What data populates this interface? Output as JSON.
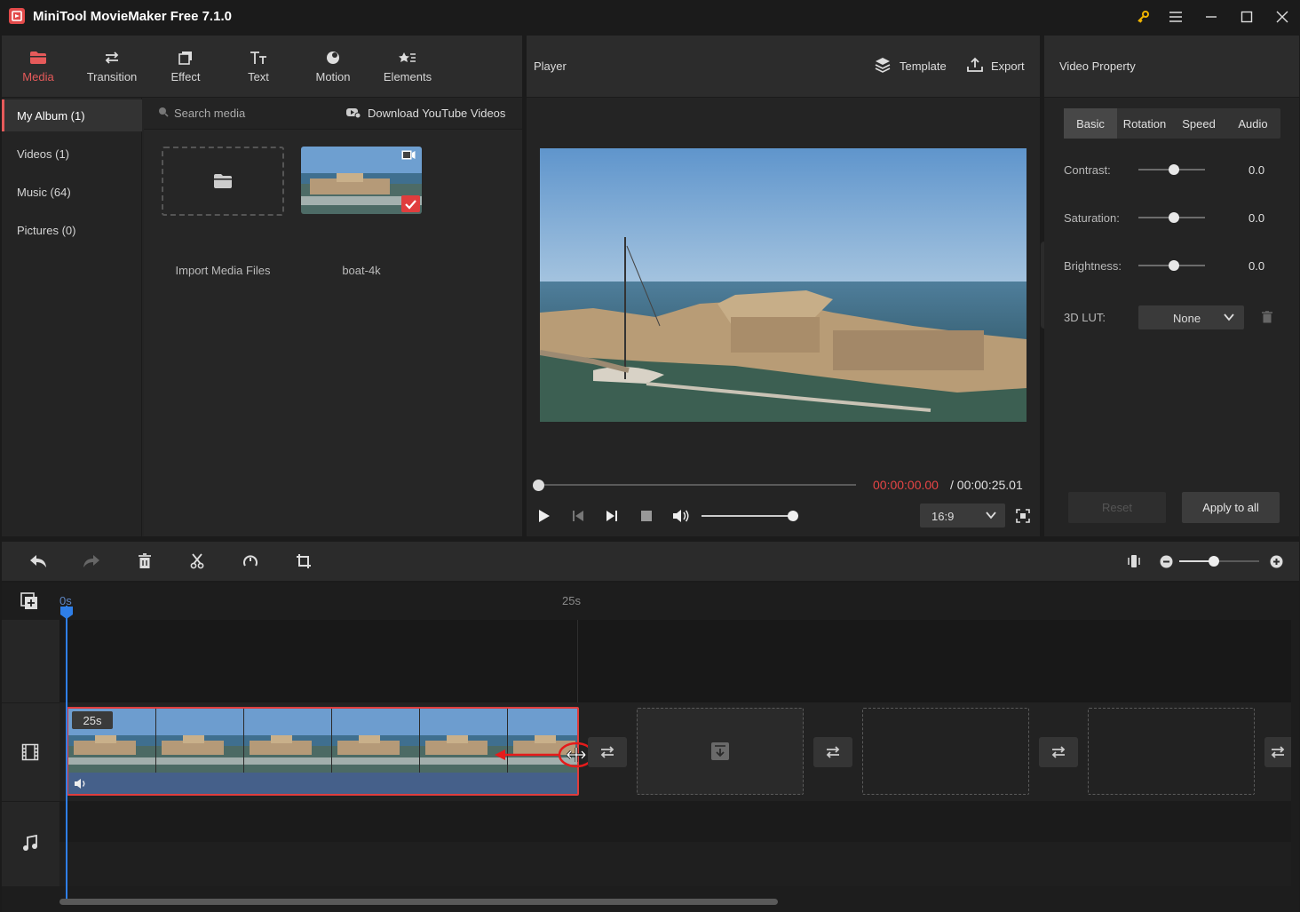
{
  "window": {
    "title": "MiniTool MovieMaker Free 7.1.0"
  },
  "nav_tabs": [
    {
      "label": "Media",
      "icon": "folder-icon",
      "active": true
    },
    {
      "label": "Transition",
      "icon": "swap-arrows-icon"
    },
    {
      "label": "Effect",
      "icon": "effect-icon"
    },
    {
      "label": "Text",
      "icon": "text-icon"
    },
    {
      "label": "Motion",
      "icon": "motion-icon"
    },
    {
      "label": "Elements",
      "icon": "elements-icon"
    }
  ],
  "sidebar": {
    "items": [
      {
        "label": "My Album (1)",
        "active": true
      },
      {
        "label": "Videos (1)"
      },
      {
        "label": "Music (64)"
      },
      {
        "label": "Pictures (0)"
      }
    ]
  },
  "media": {
    "search_placeholder": "Search media",
    "download_label": "Download YouTube Videos",
    "import_label": "Import Media Files",
    "clip_name": "boat-4k"
  },
  "player": {
    "title": "Player",
    "template_label": "Template",
    "export_label": "Export",
    "current_time": "00:00:00.00",
    "total_time": "/ 00:00:25.01",
    "aspect_ratio": "16:9",
    "progress": 0,
    "volume": 1.0
  },
  "property": {
    "title": "Video Property",
    "tabs": [
      "Basic",
      "Rotation",
      "Speed",
      "Audio"
    ],
    "contrast_label": "Contrast:",
    "contrast_value": "0.0",
    "saturation_label": "Saturation:",
    "saturation_value": "0.0",
    "brightness_label": "Brightness:",
    "brightness_value": "0.0",
    "lut_label": "3D LUT:",
    "lut_value": "None",
    "reset_label": "Reset",
    "apply_label": "Apply to all"
  },
  "timeline": {
    "ruler_start": "0s",
    "ruler_mark": "25s",
    "clip_duration": "25s",
    "zoom": 0.6
  },
  "colors": {
    "accent": "#e65a5a",
    "playhead": "#2f7fe8",
    "panel": "#242424"
  }
}
